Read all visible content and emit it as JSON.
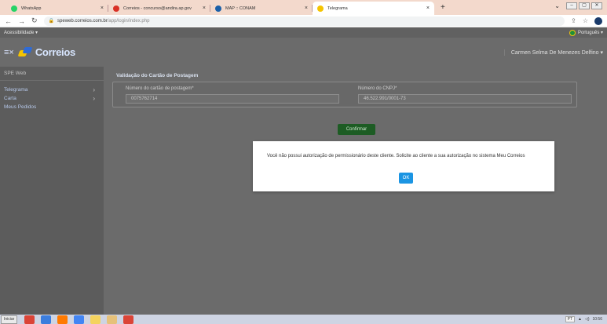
{
  "browser": {
    "tabs": [
      {
        "title": "WhatsApp",
        "icon": "whatsapp-icon",
        "color": "#25d366",
        "active": false
      },
      {
        "title": "Correios - concurso@andira.ap.gov",
        "icon": "gmail-icon",
        "color": "#d93025",
        "active": false
      },
      {
        "title": "MAP :: CONAM",
        "icon": "conam-icon",
        "color": "#1a5fa8",
        "active": false
      },
      {
        "title": "Telegrama",
        "icon": "correios-icon",
        "color": "#f5c400",
        "active": true
      }
    ],
    "new_tab": "+",
    "url_host": "speweb.correios.com.br",
    "url_path": "/app/login/index.php"
  },
  "site": {
    "accessibility_label": "Acessibilidade ▾",
    "language_label": "Português ▾",
    "logo_text": "Correios",
    "user_name": "Carmen Selma De Menezes Delfino ▾",
    "sidebar": {
      "header": "SPE Web",
      "items": [
        {
          "label": "Telegrama",
          "arrow": "›"
        },
        {
          "label": "Carta",
          "arrow": "›"
        },
        {
          "label": "Meus Pedidos",
          "arrow": ""
        }
      ]
    },
    "main": {
      "title": "Validação do Cartão de Postagem",
      "card_number_label": "Número do cartão de postagem*",
      "card_number_value": "0075762714",
      "cnpj_label": "Número do CNPJ*",
      "cnpj_value": "46.522.991/0001-73",
      "confirm_label": "Confirmar"
    },
    "modal": {
      "message": "Você não possui autorização de permissionário deste cliente. Solicite ao cliente a sua autorização no sistema Meu Correios",
      "ok_label": "OK"
    }
  },
  "taskbar": {
    "start_label": "Iniciar",
    "apps": [
      {
        "icon": "chrome-icon",
        "color": "#db4437"
      },
      {
        "icon": "mail-icon",
        "color": "#3b7ddd"
      },
      {
        "icon": "firefox-icon",
        "color": "#ff7a00"
      },
      {
        "icon": "chrome-icon",
        "color": "#4285f4"
      },
      {
        "icon": "folder-icon",
        "color": "#f4d35e"
      },
      {
        "icon": "explorer-icon",
        "color": "#e6c17a"
      },
      {
        "icon": "chrome-icon",
        "color": "#db4437"
      }
    ],
    "lang": "PT",
    "time": "10:56"
  },
  "colors": {
    "correios_yellow": "#f5c400",
    "correios_blue": "#2f6bd6",
    "confirm_green": "#1d5c24",
    "ok_blue": "#1b95e3"
  }
}
